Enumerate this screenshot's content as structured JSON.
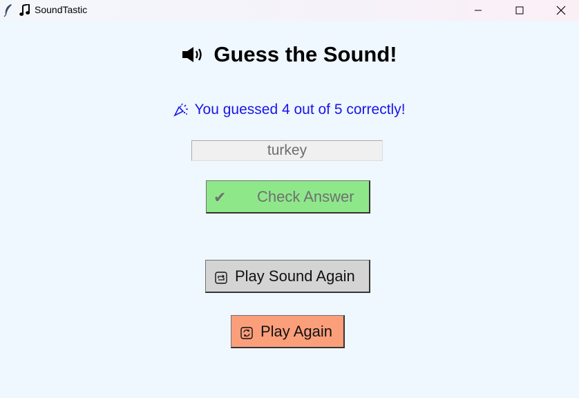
{
  "window": {
    "title": "SoundTastic",
    "app_icon": "feather-icon",
    "title_icon": "music-note-icon"
  },
  "game": {
    "heading": "Guess the Sound!",
    "heading_icon": "speaker-icon",
    "result_text": "You guessed 4 out of 5 correctly!",
    "result_icon": "party-popper-icon",
    "result_color": "#1a16e6",
    "answer_value": "turkey",
    "check_button": {
      "icon": "✔",
      "label": "Check Answer",
      "color": "#8ee88a"
    },
    "replay_button": {
      "icon": "repeat-icon",
      "label": "Play Sound Again",
      "color": "#d4d4d4"
    },
    "again_button": {
      "icon": "refresh-icon",
      "label": "Play Again",
      "color": "#fb9f7b"
    }
  }
}
